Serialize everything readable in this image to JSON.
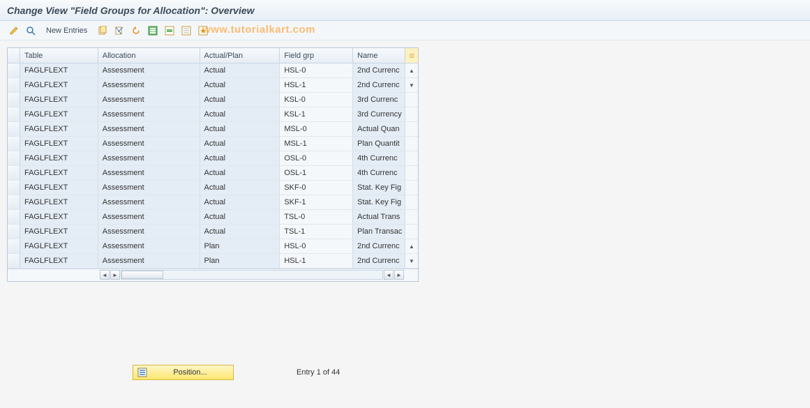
{
  "title": "Change View \"Field Groups for Allocation\": Overview",
  "watermark": "www.tutorialkart.com",
  "toolbar": {
    "new_entries": "New Entries"
  },
  "columns": {
    "table": "Table",
    "allocation": "Allocation",
    "actual_plan": "Actual/Plan",
    "field_grp": "Field grp",
    "name": "Name"
  },
  "rows": [
    {
      "table": "FAGLFLEXT",
      "allocation": "Assessment",
      "actual_plan": "Actual",
      "field_grp": "HSL-0",
      "name": "2nd Currenc"
    },
    {
      "table": "FAGLFLEXT",
      "allocation": "Assessment",
      "actual_plan": "Actual",
      "field_grp": "HSL-1",
      "name": "2nd Currenc"
    },
    {
      "table": "FAGLFLEXT",
      "allocation": "Assessment",
      "actual_plan": "Actual",
      "field_grp": "KSL-0",
      "name": "3rd Currenc"
    },
    {
      "table": "FAGLFLEXT",
      "allocation": "Assessment",
      "actual_plan": "Actual",
      "field_grp": "KSL-1",
      "name": "3rd Currency"
    },
    {
      "table": "FAGLFLEXT",
      "allocation": "Assessment",
      "actual_plan": "Actual",
      "field_grp": "MSL-0",
      "name": "Actual Quan"
    },
    {
      "table": "FAGLFLEXT",
      "allocation": "Assessment",
      "actual_plan": "Actual",
      "field_grp": "MSL-1",
      "name": "Plan Quantit"
    },
    {
      "table": "FAGLFLEXT",
      "allocation": "Assessment",
      "actual_plan": "Actual",
      "field_grp": "OSL-0",
      "name": "4th Currenc"
    },
    {
      "table": "FAGLFLEXT",
      "allocation": "Assessment",
      "actual_plan": "Actual",
      "field_grp": "OSL-1",
      "name": "4th Currenc"
    },
    {
      "table": "FAGLFLEXT",
      "allocation": "Assessment",
      "actual_plan": "Actual",
      "field_grp": "SKF-0",
      "name": "Stat. Key Fig"
    },
    {
      "table": "FAGLFLEXT",
      "allocation": "Assessment",
      "actual_plan": "Actual",
      "field_grp": "SKF-1",
      "name": "Stat. Key Fig"
    },
    {
      "table": "FAGLFLEXT",
      "allocation": "Assessment",
      "actual_plan": "Actual",
      "field_grp": "TSL-0",
      "name": "Actual Trans"
    },
    {
      "table": "FAGLFLEXT",
      "allocation": "Assessment",
      "actual_plan": "Actual",
      "field_grp": "TSL-1",
      "name": "Plan Transac"
    },
    {
      "table": "FAGLFLEXT",
      "allocation": "Assessment",
      "actual_plan": "Plan",
      "field_grp": "HSL-0",
      "name": "2nd Currenc"
    },
    {
      "table": "FAGLFLEXT",
      "allocation": "Assessment",
      "actual_plan": "Plan",
      "field_grp": "HSL-1",
      "name": "2nd Currenc"
    }
  ],
  "footer": {
    "position": "Position...",
    "entry_status": "Entry 1 of 44"
  }
}
